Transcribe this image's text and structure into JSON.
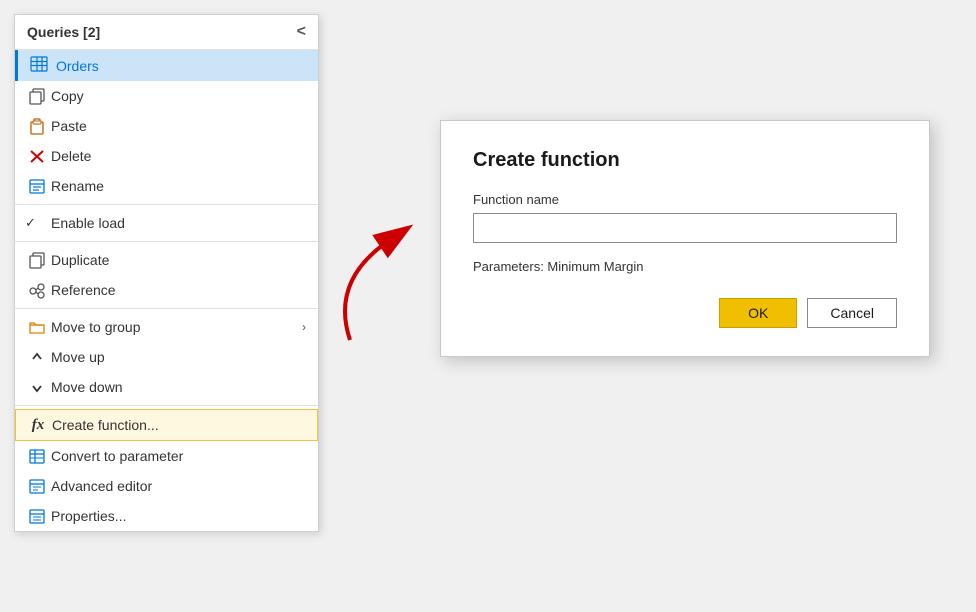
{
  "panel": {
    "title": "Queries [2]",
    "collapse_label": "<",
    "selected_item": "Orders",
    "menu_items": [
      {
        "id": "copy",
        "label": "Copy",
        "icon": "copy-icon",
        "indent": "normal"
      },
      {
        "id": "paste",
        "label": "Paste",
        "icon": "paste-icon",
        "indent": "normal"
      },
      {
        "id": "delete",
        "label": "Delete",
        "icon": "delete-icon",
        "indent": "normal"
      },
      {
        "id": "rename",
        "label": "Rename",
        "icon": "rename-icon",
        "indent": "normal"
      },
      {
        "id": "enable-load",
        "label": "Enable load",
        "icon": null,
        "indent": "normal",
        "check": true
      },
      {
        "id": "duplicate",
        "label": "Duplicate",
        "icon": "duplicate-icon",
        "indent": "normal"
      },
      {
        "id": "reference",
        "label": "Reference",
        "icon": "reference-icon",
        "indent": "normal"
      },
      {
        "id": "move-to-group",
        "label": "Move to group",
        "icon": "folder-icon",
        "indent": "normal",
        "arrow": true
      },
      {
        "id": "move-up",
        "label": "Move up",
        "icon": "moveup-icon",
        "indent": "normal"
      },
      {
        "id": "move-down",
        "label": "Move down",
        "icon": "movedown-icon",
        "indent": "normal"
      },
      {
        "id": "create-function",
        "label": "Create function...",
        "icon": "fx",
        "indent": "normal",
        "highlighted": true
      },
      {
        "id": "convert-param",
        "label": "Convert to parameter",
        "icon": "param-icon",
        "indent": "normal"
      },
      {
        "id": "advanced-editor",
        "label": "Advanced editor",
        "icon": "adveditor-icon",
        "indent": "normal"
      },
      {
        "id": "properties",
        "label": "Properties...",
        "icon": "properties-icon",
        "indent": "normal"
      }
    ]
  },
  "modal": {
    "title": "Create function",
    "label_function_name": "Function name",
    "input_placeholder": "",
    "params_label": "Parameters: Minimum Margin",
    "btn_ok": "OK",
    "btn_cancel": "Cancel"
  }
}
